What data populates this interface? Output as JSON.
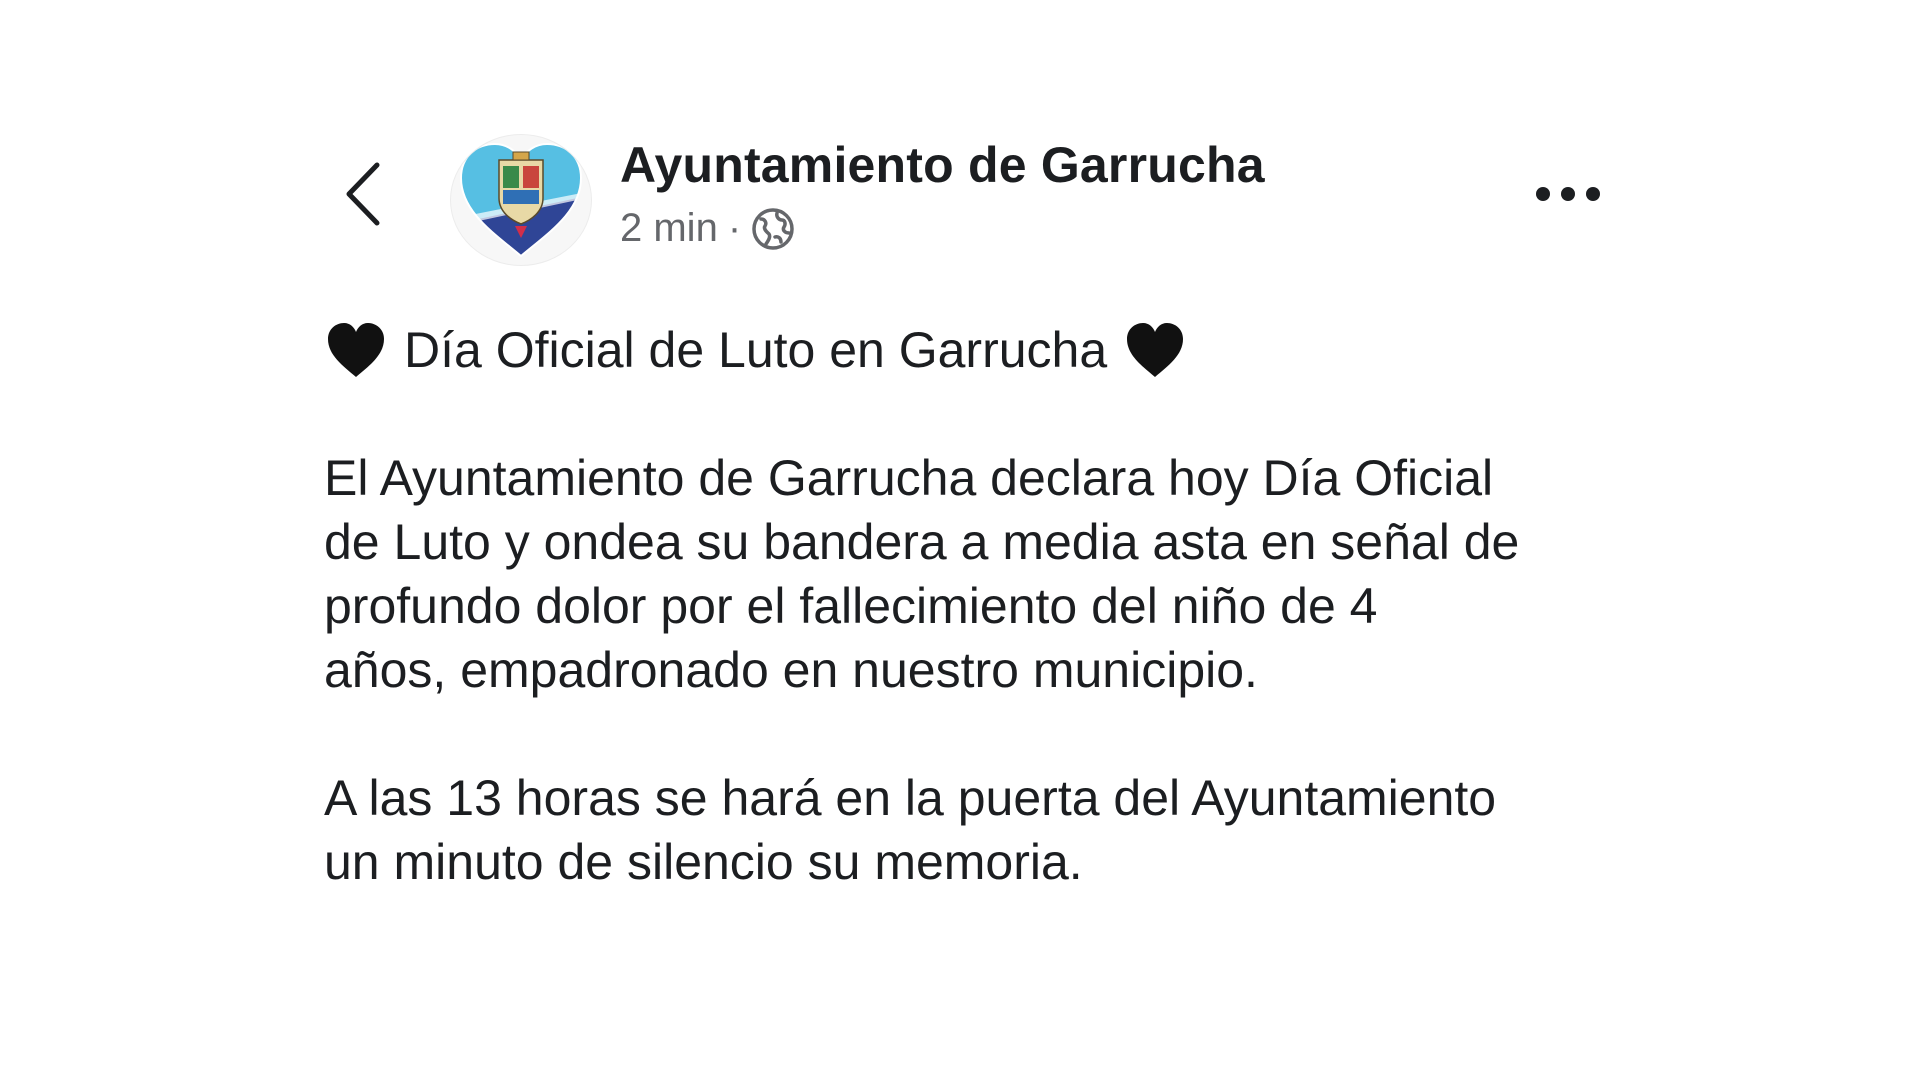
{
  "post": {
    "page_name": "Ayuntamiento de Garrucha",
    "timestamp": "2 min",
    "separator": "·",
    "audience_icon": "globe-icon",
    "title": "Día Oficial de Luto en Garrucha",
    "title_emoji": "black-heart-icon",
    "paragraph_1": "El Ayuntamiento de Garrucha declara hoy Día Oficial\nde Luto y ondea su bandera a media asta en señal de\nprofundo dolor por el fallecimiento del niño de 4\naños, empadronado en nuestro municipio.",
    "paragraph_2": "A las 13 horas se hará en la puerta del Ayuntamiento\nun minuto de silencio su memoria."
  },
  "icons": {
    "back": "chevron-left-icon",
    "more": "more-options-icon",
    "avatar": "heart-crest-logo"
  },
  "colors": {
    "text_primary": "#1c1e21",
    "text_secondary": "#65676b",
    "heart_blue": "#4fb3d9",
    "heart_navy": "#2b3f8f"
  }
}
